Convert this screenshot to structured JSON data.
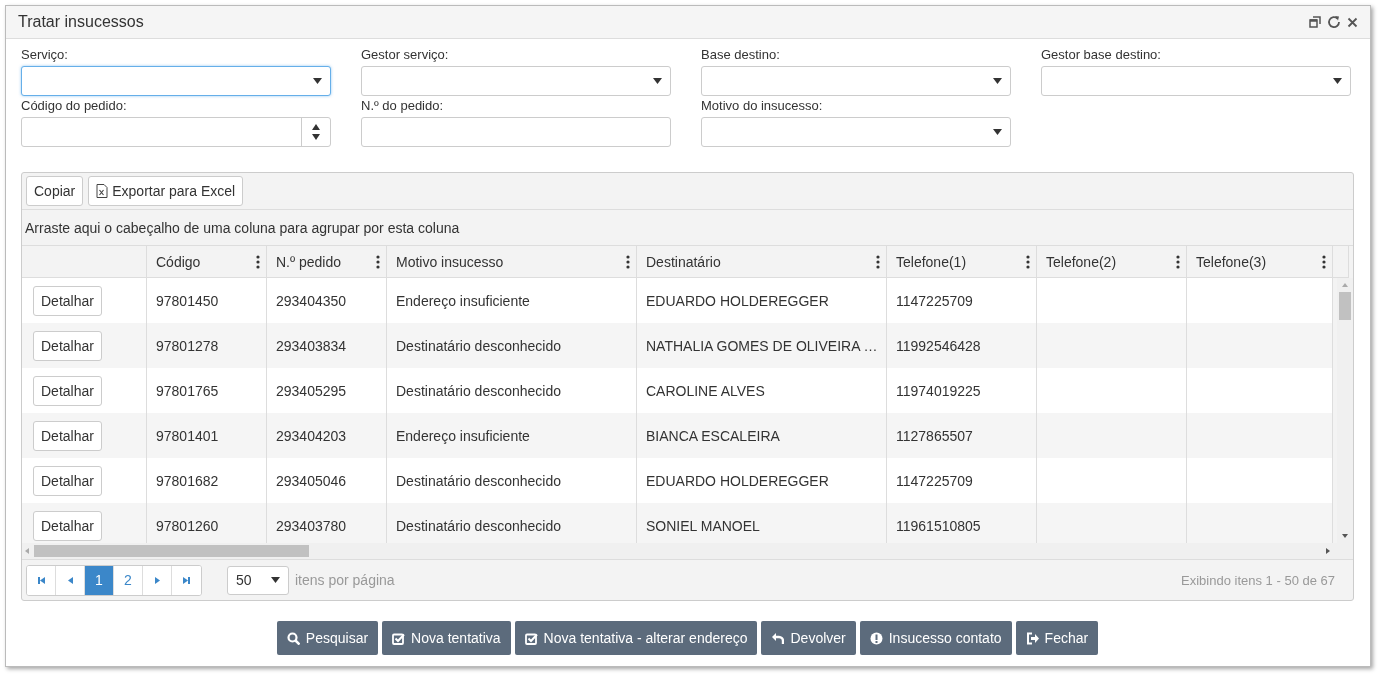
{
  "window": {
    "title": "Tratar insucessos"
  },
  "filters": [
    {
      "label": "Serviço:",
      "kind": "select",
      "focused": true
    },
    {
      "label": "Gestor serviço:",
      "kind": "select",
      "focused": false
    },
    {
      "label": "Base destino:",
      "kind": "select",
      "focused": false
    },
    {
      "label": "Gestor base destino:",
      "kind": "select",
      "focused": false
    },
    {
      "label": "Código do pedido:",
      "kind": "spinner",
      "focused": false
    },
    {
      "label": "N.º do pedido:",
      "kind": "text",
      "focused": false
    },
    {
      "label": "Motivo do insucesso:",
      "kind": "select",
      "focused": false
    }
  ],
  "grid": {
    "toolbar": [
      {
        "label": "Copiar",
        "kind": "plain"
      },
      {
        "label": "Exportar para Excel",
        "kind": "excel"
      }
    ],
    "group_hint": "Arraste aqui o cabeçalho de uma coluna para agrupar por esta coluna",
    "columns": [
      "Código",
      "N.º pedido",
      "Motivo insucesso",
      "Destinatário",
      "Telefone(1)",
      "Telefone(2)",
      "Telefone(3)"
    ],
    "rows": [
      {
        "action": "Detalhar",
        "cells": [
          "97801450",
          "293404350",
          "Endereço insuficiente",
          "EDUARDO HOLDEREGGER",
          "1147225709",
          "",
          ""
        ]
      },
      {
        "action": "Detalhar",
        "cells": [
          "97801278",
          "293403834",
          "Destinatário desconhecido",
          "NATHALIA GOMES DE OLIVEIRA …",
          "11992546428",
          "",
          ""
        ]
      },
      {
        "action": "Detalhar",
        "cells": [
          "97801765",
          "293405295",
          "Destinatário desconhecido",
          "CAROLINE ALVES",
          "11974019225",
          "",
          ""
        ]
      },
      {
        "action": "Detalhar",
        "cells": [
          "97801401",
          "293404203",
          "Endereço insuficiente",
          "BIANCA ESCALEIRA",
          "1127865507",
          "",
          ""
        ]
      },
      {
        "action": "Detalhar",
        "cells": [
          "97801682",
          "293405046",
          "Destinatário desconhecido",
          "EDUARDO HOLDEREGGER",
          "1147225709",
          "",
          ""
        ]
      },
      {
        "action": "Detalhar",
        "cells": [
          "97801260",
          "293403780",
          "Destinatário desconhecido",
          "SONIEL MANOEL",
          "11961510805",
          "",
          ""
        ]
      }
    ],
    "pager": {
      "pages": [
        {
          "label": "1",
          "selected": true
        },
        {
          "label": "2",
          "selected": false
        }
      ],
      "page_size": "50",
      "page_size_label": "itens por página",
      "summary": "Exibindo itens 1 - 50 de 67"
    }
  },
  "actions": [
    {
      "label": "Pesquisar",
      "kind": "search"
    },
    {
      "label": "Nova tentativa",
      "kind": "check"
    },
    {
      "label": "Nova tentativa - alterar endereço",
      "kind": "check"
    },
    {
      "label": "Devolver",
      "kind": "undo"
    },
    {
      "label": "Insucesso contato",
      "kind": "alert"
    },
    {
      "label": "Fechar",
      "kind": "exit"
    }
  ]
}
